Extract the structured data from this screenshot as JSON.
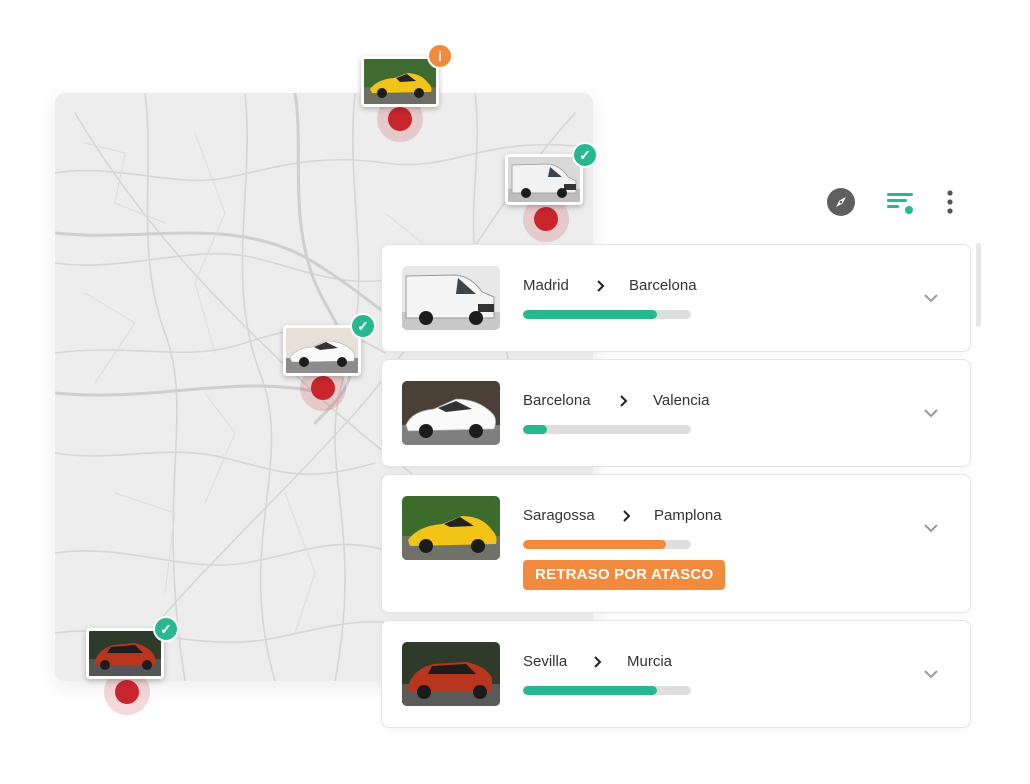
{
  "toolbar": {
    "icons": [
      "compass-icon",
      "filter-icon",
      "more-vertical-icon"
    ],
    "accent": "#27b890"
  },
  "colors": {
    "ok": "#27b890",
    "delay": "#f18a3c",
    "marker": "#c9252c",
    "track": "#dedede"
  },
  "trips": [
    {
      "from": "Madrid",
      "to": "Barcelona",
      "progress": 0.8,
      "status": "ok"
    },
    {
      "from": "Barcelona",
      "to": "Valencia",
      "progress": 0.14,
      "status": "ok"
    },
    {
      "from": "Saragossa",
      "to": "Pamplona",
      "progress": 0.85,
      "status": "delayed",
      "alert": "RETRASO POR ATASCO"
    },
    {
      "from": "Sevilla",
      "to": "Murcia",
      "progress": 0.8,
      "status": "ok"
    }
  ],
  "map_markers": [
    {
      "vehicle": "yellow sports car",
      "badge": "info-icon"
    },
    {
      "vehicle": "white van",
      "badge": "check-icon"
    },
    {
      "vehicle": "white sedan",
      "badge": "check-icon"
    },
    {
      "vehicle": "red coupe",
      "badge": "check-icon"
    }
  ],
  "badge_glyph_info": "i"
}
